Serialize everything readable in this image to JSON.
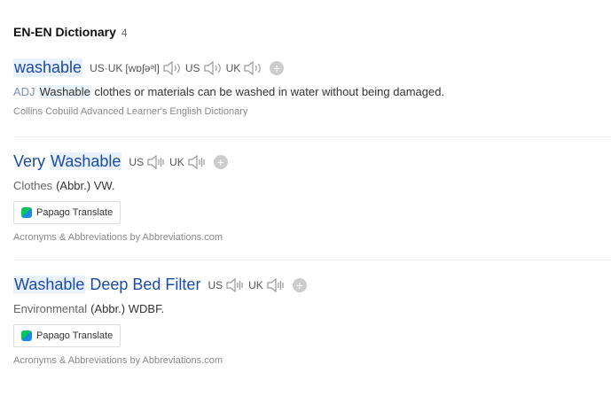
{
  "section": {
    "title": "EN-EN Dictionary",
    "count": "4"
  },
  "entries": [
    {
      "headword": "washable",
      "pron_label": "US·UK",
      "ipa": "[wɒʃəᵊl]",
      "us_label": "US",
      "uk_label": "UK",
      "pos": "ADJ",
      "def_highlight": "Washable",
      "def_rest": " clothes or materials can be washed in water without being damaged.",
      "source": "Collins Cobuild Advanced Learner's English Dictionary"
    },
    {
      "hw_a": "Very ",
      "hw_b": "Washable",
      "us_label": "US",
      "uk_label": "UK",
      "category": "Clothes",
      "abbr": "(Abbr.) VW.",
      "translate_label": "Papago Translate",
      "source": "Acronyms & Abbreviations by Abbreviations.com"
    },
    {
      "hw_a": "Washable",
      "hw_b": " Deep Bed Filter",
      "us_label": "US",
      "uk_label": "UK",
      "category": "Environmental",
      "abbr": "(Abbr.) WDBF.",
      "translate_label": "Papago Translate",
      "source": "Acronyms & Abbreviations by Abbreviations.com"
    }
  ],
  "colors": {
    "headword": "#1a4ba6",
    "highlight": "#e9f1fb",
    "papago_green": "#03c75a",
    "papago_blue": "#1e88e5"
  },
  "icons": [
    "speaker-icon",
    "add-wordbook-icon",
    "papago-logo-icon"
  ]
}
